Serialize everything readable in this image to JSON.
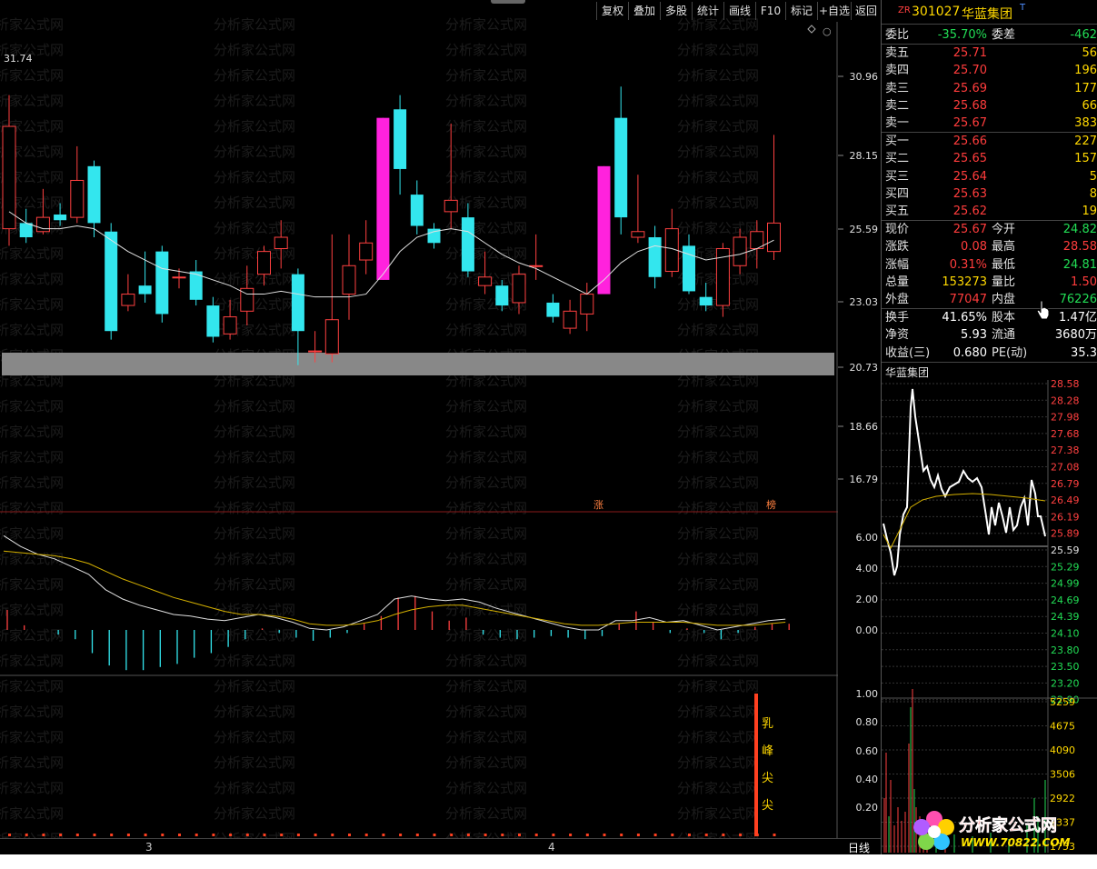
{
  "toolbar": {
    "buttons": [
      "复权",
      "叠加",
      "多股",
      "统计",
      "画线",
      "F10",
      "标记",
      "+自选",
      "返回"
    ]
  },
  "kline": {
    "high_label": "31.74",
    "price_axis": [
      "30.96",
      "28.15",
      "25.59",
      "23.03",
      "20.73",
      "18.66",
      "16.79"
    ],
    "candles": [
      {
        "o": 25.6,
        "c": 29.2,
        "h": 30.3,
        "l": 25.0
      },
      {
        "o": 25.8,
        "c": 25.3,
        "h": 26.3,
        "l": 25.1
      },
      {
        "o": 25.5,
        "c": 26.0,
        "h": 27.0,
        "l": 25.4
      },
      {
        "o": 26.1,
        "c": 25.9,
        "h": 26.5,
        "l": 25.7
      },
      {
        "o": 26.0,
        "c": 27.3,
        "h": 28.5,
        "l": 25.8
      },
      {
        "o": 27.8,
        "c": 25.8,
        "h": 28.0,
        "l": 25.3
      },
      {
        "o": 25.5,
        "c": 22.0,
        "h": 25.8,
        "l": 21.7
      },
      {
        "o": 22.9,
        "c": 23.3,
        "h": 24.0,
        "l": 22.7
      },
      {
        "o": 23.6,
        "c": 23.3,
        "h": 24.8,
        "l": 23.0
      },
      {
        "o": 24.8,
        "c": 22.6,
        "h": 25.0,
        "l": 22.3
      },
      {
        "o": 23.9,
        "c": 23.9,
        "h": 24.2,
        "l": 23.5
      },
      {
        "o": 24.1,
        "c": 23.1,
        "h": 24.5,
        "l": 22.9
      },
      {
        "o": 22.9,
        "c": 21.8,
        "h": 23.2,
        "l": 21.6
      },
      {
        "o": 21.9,
        "c": 22.5,
        "h": 23.1,
        "l": 21.7
      },
      {
        "o": 22.7,
        "c": 23.5,
        "h": 24.3,
        "l": 22.2
      },
      {
        "o": 24.0,
        "c": 24.8,
        "h": 25.0,
        "l": 23.6
      },
      {
        "o": 24.9,
        "c": 25.3,
        "h": 25.9,
        "l": 24.2
      },
      {
        "o": 24.0,
        "c": 22.0,
        "h": 24.2,
        "l": 20.8
      },
      {
        "o": 21.3,
        "c": 21.3,
        "h": 22.0,
        "l": 20.9
      },
      {
        "o": 21.2,
        "c": 22.4,
        "h": 25.4,
        "l": 20.9
      },
      {
        "o": 23.3,
        "c": 24.3,
        "h": 25.4,
        "l": 22.4
      },
      {
        "o": 24.5,
        "c": 25.1,
        "h": 25.9,
        "l": 24.0
      },
      {
        "o": 23.8,
        "c": 29.5,
        "h": 29.5,
        "l": 23.8
      },
      {
        "o": 29.8,
        "c": 27.7,
        "h": 30.3,
        "l": 26.8
      },
      {
        "o": 26.8,
        "c": 25.7,
        "h": 27.3,
        "l": 25.4
      },
      {
        "o": 25.6,
        "c": 25.1,
        "h": 25.8,
        "l": 24.9
      },
      {
        "o": 26.2,
        "c": 26.6,
        "h": 29.3,
        "l": 25.6
      },
      {
        "o": 26.0,
        "c": 24.1,
        "h": 26.5,
        "l": 23.9
      },
      {
        "o": 23.6,
        "c": 23.9,
        "h": 24.8,
        "l": 23.3
      },
      {
        "o": 23.6,
        "c": 22.9,
        "h": 23.8,
        "l": 22.7
      },
      {
        "o": 23.0,
        "c": 24.0,
        "h": 24.3,
        "l": 22.6
      },
      {
        "o": 24.3,
        "c": 24.3,
        "h": 25.4,
        "l": 23.8
      },
      {
        "o": 23.0,
        "c": 22.5,
        "h": 23.3,
        "l": 22.3
      },
      {
        "o": 22.1,
        "c": 22.7,
        "h": 23.1,
        "l": 21.9
      },
      {
        "o": 22.6,
        "c": 23.3,
        "h": 23.7,
        "l": 22.0
      },
      {
        "o": 23.3,
        "c": 27.8,
        "h": 27.8,
        "l": 23.3
      },
      {
        "o": 29.5,
        "c": 26.0,
        "h": 30.6,
        "l": 25.4
      },
      {
        "o": 25.3,
        "c": 25.5,
        "h": 27.5,
        "l": 25.1
      },
      {
        "o": 25.3,
        "c": 23.9,
        "h": 25.7,
        "l": 23.5
      },
      {
        "o": 24.1,
        "c": 25.6,
        "h": 26.3,
        "l": 23.9
      },
      {
        "o": 25.0,
        "c": 23.4,
        "h": 25.4,
        "l": 23.3
      },
      {
        "o": 23.2,
        "c": 22.9,
        "h": 23.7,
        "l": 22.7
      },
      {
        "o": 22.9,
        "c": 24.9,
        "h": 25.1,
        "l": 22.5
      },
      {
        "o": 24.3,
        "c": 25.3,
        "h": 25.6,
        "l": 24.0
      },
      {
        "o": 24.9,
        "c": 25.5,
        "h": 25.9,
        "l": 24.2
      },
      {
        "o": 24.8,
        "c": 25.8,
        "h": 28.9,
        "l": 24.5
      }
    ],
    "ma": [
      26.2,
      25.8,
      25.6,
      25.6,
      25.7,
      25.6,
      25.2,
      24.8,
      24.5,
      24.2,
      24.1,
      24.0,
      23.8,
      23.6,
      23.3,
      23.3,
      23.4,
      23.3,
      23.2,
      23.2,
      23.2,
      23.3,
      24.0,
      24.8,
      25.3,
      25.5,
      25.6,
      25.5,
      25.1,
      24.7,
      24.4,
      24.2,
      23.9,
      23.6,
      23.3,
      23.8,
      24.4,
      24.8,
      25.0,
      24.9,
      24.7,
      24.5,
      24.6,
      24.7,
      24.9,
      25.2
    ],
    "mark_zhang": "涨",
    "mark_bang": "榜"
  },
  "macd": {
    "axis": [
      "6.00",
      "4.00",
      "2.00",
      "0.00"
    ],
    "dif": [
      6.1,
      5.4,
      4.9,
      4.6,
      4.1,
      3.6,
      2.6,
      2.0,
      1.6,
      1.3,
      1.0,
      0.9,
      0.7,
      0.6,
      0.8,
      1.0,
      0.8,
      0.5,
      0.1,
      0.0,
      0.2,
      0.6,
      1.0,
      2.0,
      2.2,
      2.0,
      1.9,
      2.0,
      1.8,
      1.4,
      1.1,
      0.8,
      0.5,
      0.2,
      0.0,
      0.0,
      0.6,
      0.6,
      0.8,
      0.5,
      0.6,
      0.3,
      0.0,
      0.2,
      0.4,
      0.6,
      0.7
    ],
    "dea": [
      5.1,
      5.0,
      4.9,
      4.8,
      4.6,
      4.3,
      3.8,
      3.3,
      2.9,
      2.5,
      2.1,
      1.8,
      1.5,
      1.2,
      1.0,
      1.0,
      0.9,
      0.7,
      0.4,
      0.3,
      0.3,
      0.4,
      0.6,
      1.0,
      1.3,
      1.5,
      1.6,
      1.6,
      1.4,
      1.2,
      1.0,
      0.8,
      0.6,
      0.4,
      0.3,
      0.3,
      0.4,
      0.5,
      0.5,
      0.5,
      0.5,
      0.4,
      0.3,
      0.3,
      0.3,
      0.4,
      0.5
    ],
    "hist": [
      1.3,
      0.3,
      0.0,
      -0.3,
      -0.6,
      -1.5,
      -2.3,
      -2.6,
      -2.6,
      -2.4,
      -2.2,
      -1.8,
      -1.5,
      -1.1,
      -0.6,
      0.1,
      -0.2,
      -0.5,
      -0.7,
      -0.5,
      -0.2,
      0.4,
      0.9,
      2.1,
      2.2,
      1.2,
      0.6,
      0.8,
      -0.3,
      -0.5,
      -0.6,
      -0.5,
      -0.4,
      -0.5,
      -0.6,
      -0.4,
      0.4,
      1.2,
      0.5,
      -0.2,
      0.1,
      -0.2,
      -0.6,
      -0.2,
      0.2,
      0.4,
      0.4
    ]
  },
  "indicator": {
    "axis": [
      "1.00",
      "0.80",
      "0.60",
      "0.40",
      "0.20"
    ],
    "signal_chars": [
      "乳",
      "峰",
      "尖",
      "尖"
    ]
  },
  "statusbar": {
    "month_labels": [
      "3",
      "4"
    ],
    "period": "日线"
  },
  "quote": {
    "prefix": "ZR",
    "code": "301027",
    "name": "华蓝集团",
    "suffix": "T",
    "weibi_label": "委比",
    "weibi_value": "-35.70%",
    "weicha_label": "委差",
    "weicha_value": "-462",
    "asks": [
      {
        "label": "卖五",
        "price": "25.71",
        "vol": "56"
      },
      {
        "label": "卖四",
        "price": "25.70",
        "vol": "196"
      },
      {
        "label": "卖三",
        "price": "25.69",
        "vol": "177"
      },
      {
        "label": "卖二",
        "price": "25.68",
        "vol": "66"
      },
      {
        "label": "卖一",
        "price": "25.67",
        "vol": "383"
      }
    ],
    "bids": [
      {
        "label": "买一",
        "price": "25.66",
        "vol": "227"
      },
      {
        "label": "买二",
        "price": "25.65",
        "vol": "157"
      },
      {
        "label": "买三",
        "price": "25.64",
        "vol": "5"
      },
      {
        "label": "买四",
        "price": "25.63",
        "vol": "8"
      },
      {
        "label": "买五",
        "price": "25.62",
        "vol": "19"
      }
    ],
    "stats": [
      {
        "l1": "现价",
        "v1": "25.67",
        "c1": "red",
        "l2": "今开",
        "v2": "24.82",
        "c2": "green"
      },
      {
        "l1": "涨跌",
        "v1": "0.08",
        "c1": "red",
        "l2": "最高",
        "v2": "28.58",
        "c2": "red"
      },
      {
        "l1": "涨幅",
        "v1": "0.31%",
        "c1": "red",
        "l2": "最低",
        "v2": "24.81",
        "c2": "green"
      },
      {
        "l1": "总量",
        "v1": "153273",
        "c1": "yellow",
        "l2": "量比",
        "v2": "1.50",
        "c2": "red"
      },
      {
        "l1": "外盘",
        "v1": "77047",
        "c1": "red",
        "l2": "内盘",
        "v2": "76226",
        "c2": "green"
      }
    ],
    "stats2": [
      {
        "l1": "换手",
        "v1": "41.65%",
        "l2": "股本",
        "v2": "1.47亿"
      },
      {
        "l1": "净资",
        "v1": "5.93",
        "l2": "流通",
        "v2": "3680万"
      },
      {
        "l1": "收益(三)",
        "v1": "0.680",
        "l2": "PE(动)",
        "v2": "35.3"
      }
    ]
  },
  "intraday": {
    "title": "华蓝集团",
    "price_axis": [
      "28.58",
      "28.28",
      "27.98",
      "27.68",
      "27.38",
      "27.08",
      "26.79",
      "26.49",
      "26.19",
      "25.89",
      "25.59",
      "25.29",
      "24.99",
      "24.69",
      "24.39",
      "24.10",
      "23.80",
      "23.50",
      "23.20",
      "22.90"
    ],
    "vol_axis": [
      "5259",
      "4675",
      "4090",
      "3506",
      "2922",
      "2337",
      "1753"
    ]
  },
  "watermark": {
    "main": "分析家公式网",
    "url": "WWW.70822.COM"
  }
}
